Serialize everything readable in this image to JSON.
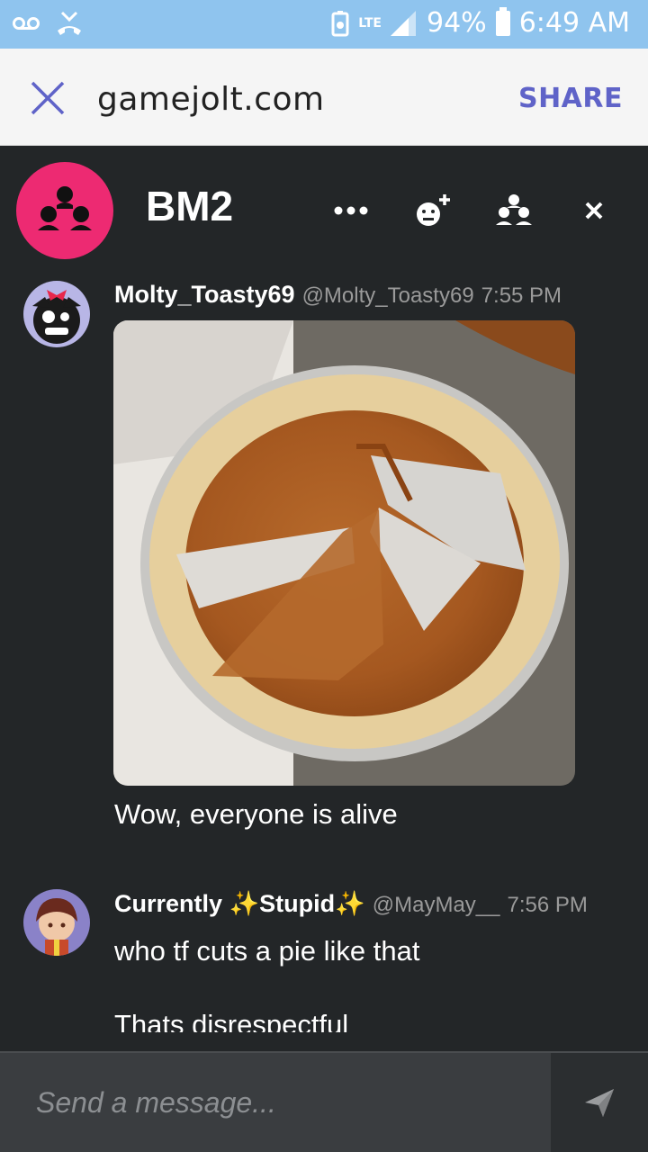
{
  "status_bar": {
    "network": "LTE",
    "battery": "94%",
    "time": "6:49 AM",
    "icons": [
      "voicemail-icon",
      "missed-call-icon",
      "battery-saver-icon",
      "signal-icon",
      "battery-icon"
    ]
  },
  "browser": {
    "url": "gamejolt.com",
    "share_label": "SHARE",
    "close_icon": "close-icon"
  },
  "chat": {
    "title": "BM2",
    "accent": "#ed2a72",
    "header_icons": [
      "more-icon",
      "add-friend-icon",
      "members-icon",
      "close-icon"
    ]
  },
  "messages": [
    {
      "username": "Molty_Toasty69",
      "handle": "@Molty_Toasty69",
      "time": "7:55 PM",
      "image": "pumpkin-pie-photo",
      "text": "Wow, everyone is alive"
    },
    {
      "username": "Currently ✨Stupid✨",
      "handle": "@MayMay__",
      "time": "7:56 PM",
      "text_lines": [
        "who tf cuts a pie like that",
        "Thats disrespectful"
      ]
    }
  ],
  "composer": {
    "placeholder": "Send a message...",
    "send_icon": "send-icon"
  }
}
